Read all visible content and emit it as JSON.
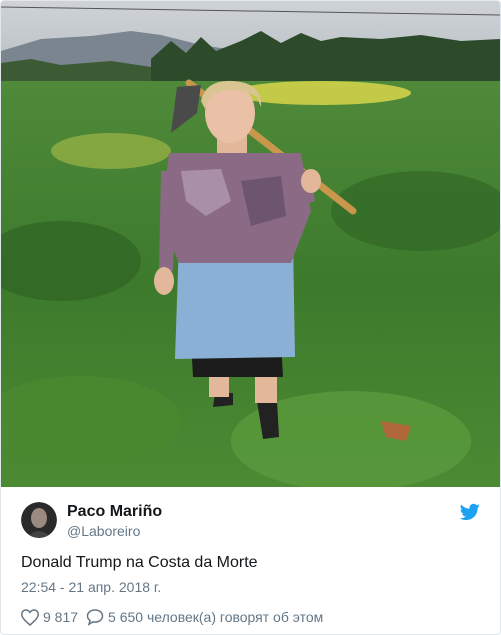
{
  "tweet": {
    "photo": {
      "icon": "photo-field-woman-with-hoe",
      "sky_color": "#c9ced3",
      "field_color": "#3f7a2e",
      "flower_color": "#d8d64a"
    },
    "author": {
      "avatar_icon": "profile-photo",
      "name": "Paco Mariño",
      "handle": "@Laboreiro"
    },
    "brand_icon": "twitter-bird-icon",
    "brand_color": "#1da1f2",
    "text": "Donald Trump na Costa da Morte",
    "timestamp": "22:54 - 21 апр. 2018 г.",
    "actions": {
      "like_icon": "heart-icon",
      "like_count": "9 817",
      "reply_icon": "speech-bubble-icon",
      "conversation_label": "5 650 человек(а) говорят об этом"
    }
  }
}
